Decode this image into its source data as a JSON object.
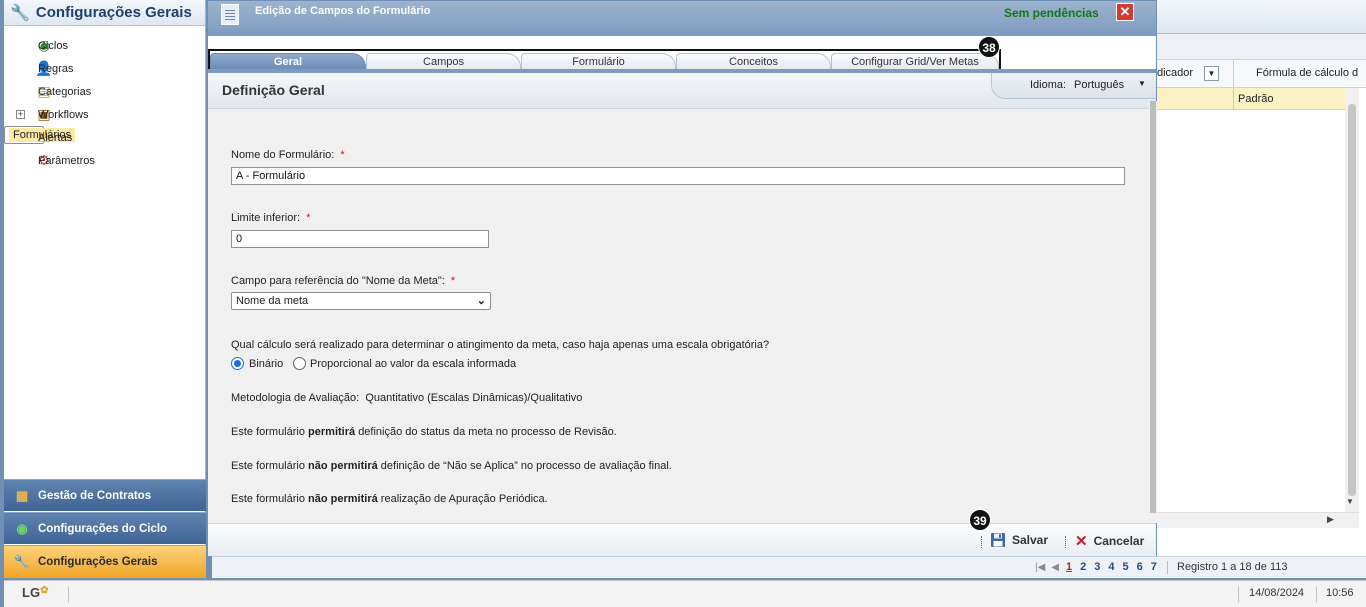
{
  "left_panel": {
    "title": "Configurações Gerais",
    "items": [
      {
        "label": "Ciclos",
        "icon": "cycle-icon"
      },
      {
        "label": "Regras",
        "icon": "person-icon"
      },
      {
        "label": "Categorias",
        "icon": "categories-icon"
      },
      {
        "label": "Workflows",
        "icon": "workflow-icon"
      },
      {
        "label": "Formulários",
        "icon": "form-icon"
      },
      {
        "label": "Alertas",
        "icon": "warning-icon"
      },
      {
        "label": "Parâmetros",
        "icon": "gear-icon"
      }
    ],
    "nav": {
      "contracts": "Gestão de Contratos",
      "cycle_config": "Configurações do Ciclo",
      "general_config": "Configurações Gerais"
    }
  },
  "background_grid": {
    "col1": "dicador",
    "col2": "Fórmula de cálculo d",
    "row_value": "Padrão"
  },
  "pager": {
    "pages": [
      "1",
      "2",
      "3",
      "4",
      "5",
      "6",
      "7"
    ],
    "current": "1",
    "summary": "Registro 1 a 18 de 113"
  },
  "status": {
    "logo": "LG",
    "date": "14/08/2024",
    "time": "10:56"
  },
  "modal": {
    "title": "Edição de Campos do Formulário",
    "pending": "Sem pendências",
    "tabs": [
      "Geral",
      "Campos",
      "Formulário",
      "Conceitos",
      "Configurar Grid/Ver Metas"
    ],
    "active_tab": "Geral",
    "badge_tabs": "38",
    "badge_save": "39",
    "section_title": "Definição Geral",
    "language_label": "Idioma:",
    "language_value": "Português",
    "form": {
      "name_label": "Nome do Formulário:",
      "name_value": "A - Formulário",
      "lower_label": "Limite inferior:",
      "lower_value": "0",
      "ref_label": "Campo para referência do \"Nome da Meta\":",
      "ref_value": "Nome da meta",
      "calc_question": "Qual cálculo será realizado para determinar o atingimento da meta, caso haja apenas uma escala obrigatória?",
      "opt_binary": "Binário",
      "opt_prop": "Proporcional ao valor da escala informada",
      "method_label": "Metodologia de Avaliação:",
      "method_value": "Quantitativo (Escalas Dinâmicas)/Qualitativo",
      "line1_pre": "Este formulário",
      "line1_bold": "permitirá",
      "line1_post": "definição do status da meta no processo de Revisão.",
      "line2_pre": "Este formulário",
      "line2_bold": "não permitirá",
      "line2_post": "definição de “Não se Aplica” no processo de avaliação final.",
      "line3_pre": "Este formulário",
      "line3_bold": "não permitirá",
      "line3_post": "realização de Apuração Periódica."
    },
    "save_label": "Salvar",
    "cancel_label": "Cancelar"
  },
  "colors": {
    "nav_blue": "#3f6595",
    "nav_orange": "#f2a526",
    "pending_green": "#0f7a0f",
    "required_red": "#dd1111"
  }
}
